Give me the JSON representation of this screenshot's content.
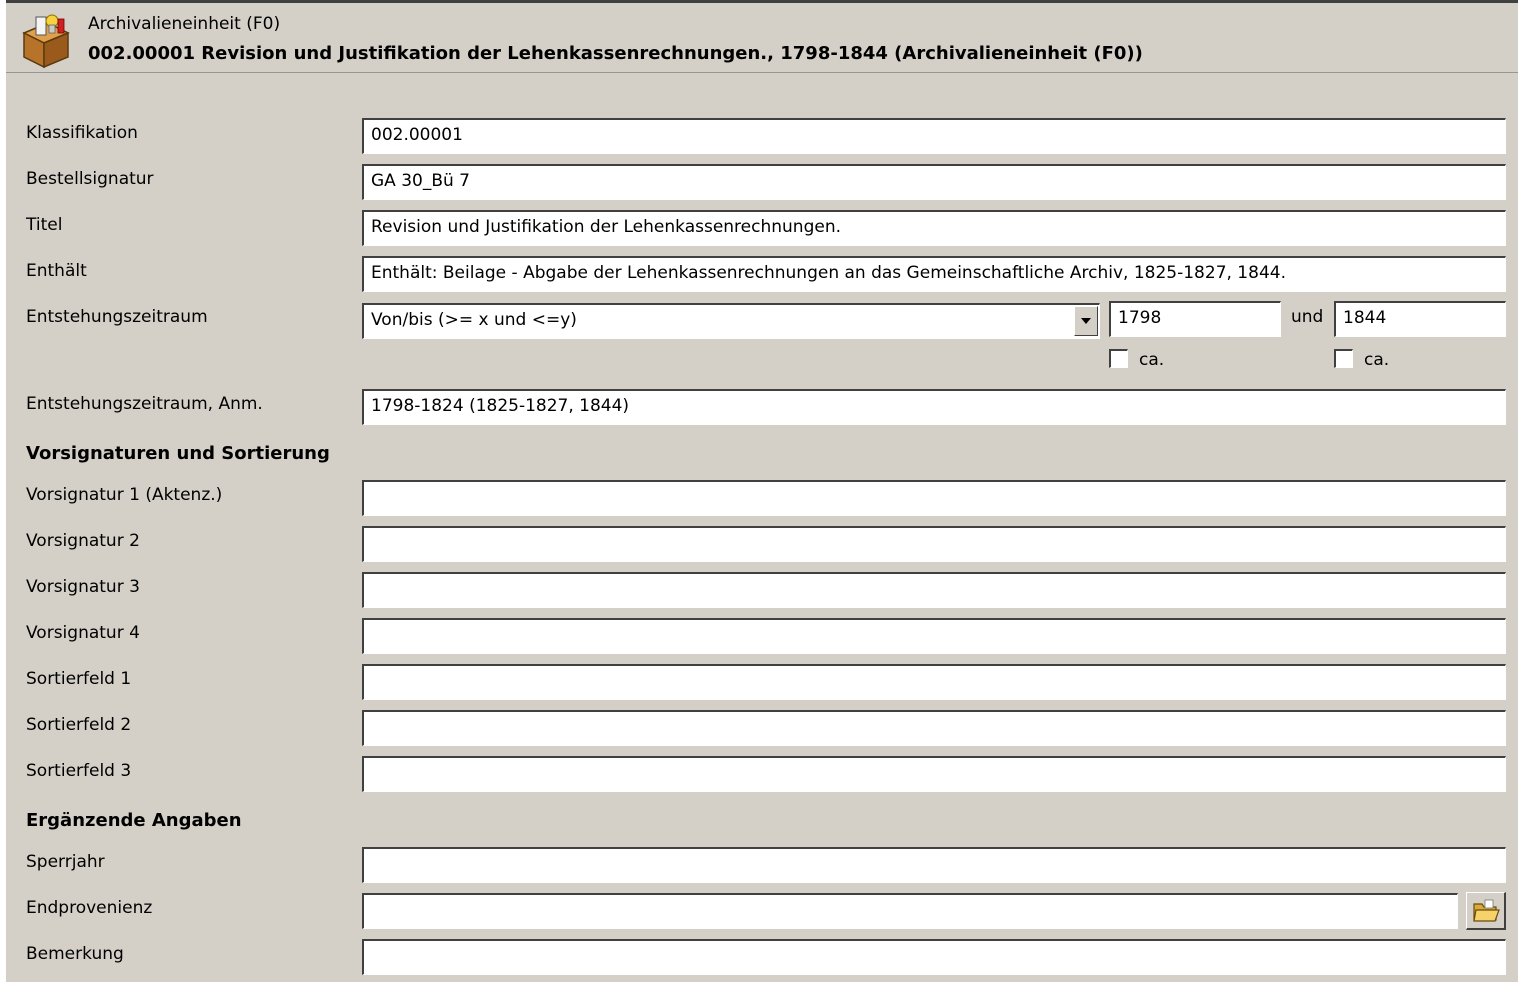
{
  "header": {
    "subtitle": "Archivalieneinheit (F0)",
    "title": "002.00001   Revision und Justifikation der Lehenkassenrechnungen., 1798-1844 (Archivalieneinheit (F0))",
    "icon": "archive-box-icon"
  },
  "fields": {
    "klassifikation": {
      "label": "Klassifikation",
      "value": "002.00001"
    },
    "bestellsignatur": {
      "label": "Bestellsignatur",
      "value": "GA 30_Bü 7"
    },
    "titel": {
      "label": "Titel",
      "value": "Revision und Justifikation der Lehenkassenrechnungen."
    },
    "enthaelt": {
      "label": "Enthält",
      "value": "Enthält: Beilage - Abgabe der Lehenkassenrechnungen an das  Gemeinschaftliche Archiv, 1825-1827, 1844."
    },
    "entstehungszeitraum": {
      "label": "Entstehungszeitraum",
      "mode": "Von/bis (>= x und <=y)",
      "from": "1798",
      "and_label": "und",
      "to": "1844",
      "ca_label": "ca."
    },
    "entstehungszeitraum_anm": {
      "label": "Entstehungszeitraum, Anm.",
      "value": "1798-1824 (1825-1827, 1844)"
    }
  },
  "section_vorsignaturen": {
    "title": "Vorsignaturen und Sortierung",
    "items": [
      {
        "label": "Vorsignatur 1 (Aktenz.)",
        "value": ""
      },
      {
        "label": "Vorsignatur 2",
        "value": ""
      },
      {
        "label": "Vorsignatur 3",
        "value": ""
      },
      {
        "label": "Vorsignatur 4",
        "value": ""
      },
      {
        "label": "Sortierfeld 1",
        "value": ""
      },
      {
        "label": "Sortierfeld 2",
        "value": ""
      },
      {
        "label": "Sortierfeld 3",
        "value": ""
      }
    ]
  },
  "section_ergaenzend": {
    "title": "Ergänzende Angaben",
    "sperrjahr": {
      "label": "Sperrjahr",
      "value": ""
    },
    "endprovenienz": {
      "label": "Endprovenienz",
      "value": ""
    },
    "bemerkung": {
      "label": "Bemerkung",
      "value": ""
    }
  }
}
